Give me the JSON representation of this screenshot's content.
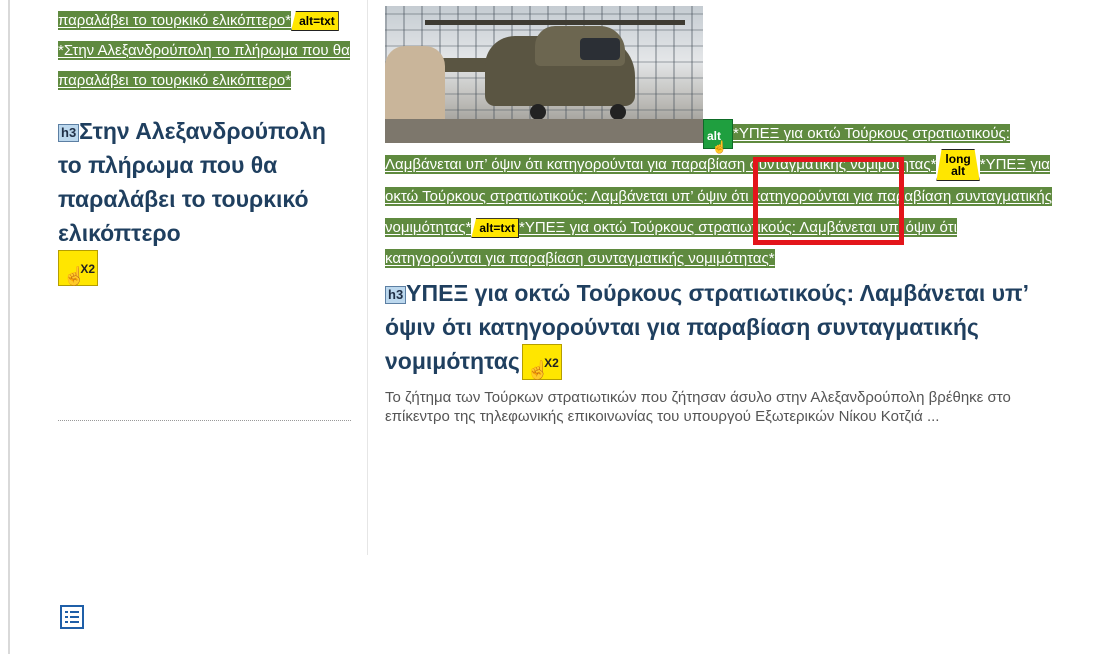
{
  "left": {
    "highlighted_text": "παραλάβει το τουρκικό ελικόπτερο*",
    "badge_alt_txt": "alt=txt",
    "highlighted_text_2": "*Στην Αλεξανδρούπολη το πλήρωμα που θα παραλάβει το τουρκικό ελικόπτερο*",
    "h3_badge": "h3",
    "heading": "Στην Αλεξανδρούπολη το πλήρωμα που θα παραλάβει το τουρκικό ελικόπτερο",
    "x2_label": "X2"
  },
  "right": {
    "alt_badge": "alt",
    "highlight_1": "*ΥΠΕΞ για οκτώ Τούρκους στρατιωτικούς: Λαμβάνεται υπ’ όψιν ότι κατηγορούνται για παραβίαση συνταγματικής νομιμότητας*",
    "long_alt_line1": "long",
    "long_alt_line2": "alt",
    "highlight_2": "*ΥΠΕΞ για οκτώ Τούρκους στρατιωτικούς: Λαμβάνεται υπ’ όψιν ότι κατηγορούνται για παραβίαση συνταγματικής νομιμότητας*",
    "badge_alt_txt": "alt=txt",
    "highlight_3": "*ΥΠΕΞ για οκτώ Τούρκους στρατιωτικούς: Λαμβάνεται υπ’ όψιν ότι κατηγορούνται για παραβίαση συνταγματικής νομιμότητας*",
    "h3_badge": "h3",
    "heading": "ΥΠΕΞ για οκτώ Τούρκους στρατιωτικούς: Λαμβάνεται υπ’ όψιν ότι κατηγορούνται για παραβίαση συνταγματικής νομιμότητας",
    "x2_label": "X2",
    "summary": "Το ζήτημα των Τούρκων στρατιωτικών που ζήτησαν άσυλο στην Αλεξανδρούπολη βρέθηκε στο επίκεντρο της τηλεφωνικής επικοινωνίας του υπουργού Εξωτερικών Νίκου Κοτζιά ..."
  },
  "icons": {
    "list": "list-icon",
    "hand": "hand-pointer-icon"
  },
  "colors": {
    "highlight_green": "#5f8a3f",
    "badge_yellow": "#ffe600",
    "heading_blue": "#1f3f5f",
    "red_focus": "#e3151b"
  }
}
